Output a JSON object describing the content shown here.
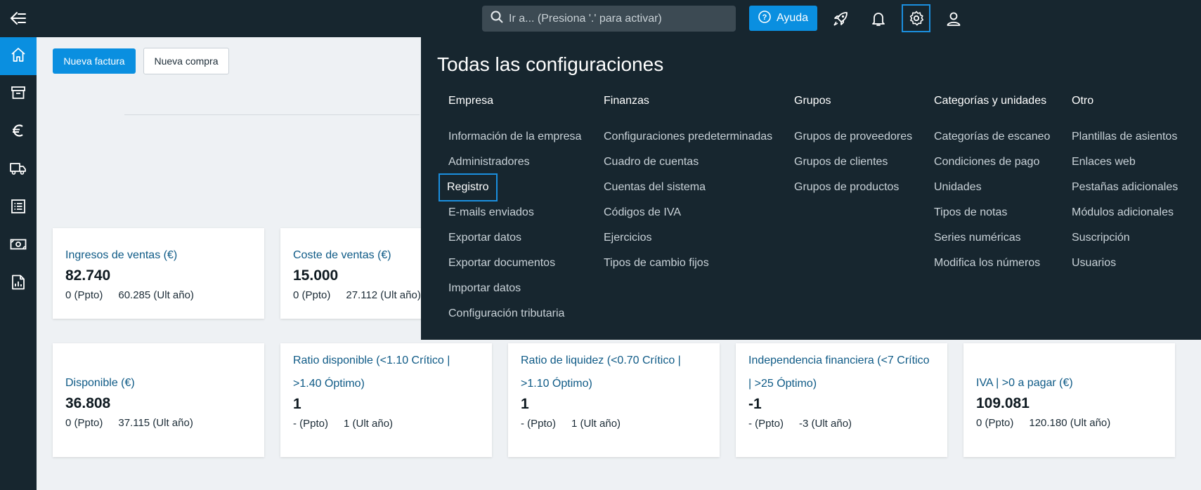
{
  "topbar": {
    "search_placeholder": "Ir a... (Presiona '.' para activar)",
    "help_label": "Ayuda"
  },
  "actions": {
    "new_invoice": "Nueva factura",
    "new_purchase": "Nueva compra"
  },
  "sidebar_icons": [
    "home-icon",
    "archive-icon",
    "euro-icon",
    "truck-icon",
    "list-icon",
    "cash-icon",
    "report-icon"
  ],
  "cards_row1": [
    {
      "title": "Ingresos de ventas (€)",
      "value": "82.740",
      "budget": "0 (Ppto)",
      "last_year": "60.285 (Ult año)"
    },
    {
      "title": "Coste de ventas (€)",
      "value": "15.000",
      "budget": "0 (Ppto)",
      "last_year": "27.112 (Ult año)"
    }
  ],
  "cards_row2": [
    {
      "title": "Disponible (€)",
      "value": "36.808",
      "budget": "0 (Ppto)",
      "last_year": "37.115 (Ult año)"
    },
    {
      "title": "Ratio disponible (<1.10 Crítico | >1.40 Óptimo)",
      "value": "1",
      "budget": "- (Ppto)",
      "last_year": "1 (Ult año)"
    },
    {
      "title": "Ratio de liquidez (<0.70 Crítico | >1.10 Óptimo)",
      "value": "1",
      "budget": "- (Ppto)",
      "last_year": "1 (Ult año)"
    },
    {
      "title": "Independencia financiera (<7 Crítico | >25 Óptimo)",
      "value": "-1",
      "budget": "- (Ppto)",
      "last_year": "-3 (Ult año)"
    },
    {
      "title": "IVA | >0 a pagar (€)",
      "value": "109.081",
      "budget": "0 (Ppto)",
      "last_year": "120.180 (Ult año)"
    }
  ],
  "settings": {
    "title": "Todas las configuraciones",
    "columns": [
      {
        "heading": "Empresa",
        "items": [
          "Información de la empresa",
          "Administradores",
          "Registro",
          "E-mails enviados",
          "Exportar datos",
          "Exportar documentos",
          "Importar datos",
          "Configuración tributaria"
        ]
      },
      {
        "heading": "Finanzas",
        "items": [
          "Configuraciones predeterminadas",
          "Cuadro de cuentas",
          "Cuentas del sistema",
          "Códigos de IVA",
          "Ejercicios",
          "Tipos de cambio fijos"
        ]
      },
      {
        "heading": "Grupos",
        "items": [
          "Grupos de proveedores",
          "Grupos de clientes",
          "Grupos de productos"
        ]
      },
      {
        "heading": "Categorías y unidades",
        "items": [
          "Categorías de escaneo",
          "Condiciones de pago",
          "Unidades",
          "Tipos de notas",
          "Series numéricas",
          "Modifica los números"
        ]
      },
      {
        "heading": "Otro",
        "items": [
          "Plantillas de asientos",
          "Enlaces web",
          "Pestañas adicionales",
          "Módulos adicionales",
          "Suscripción",
          "Usuarios"
        ]
      }
    ]
  }
}
